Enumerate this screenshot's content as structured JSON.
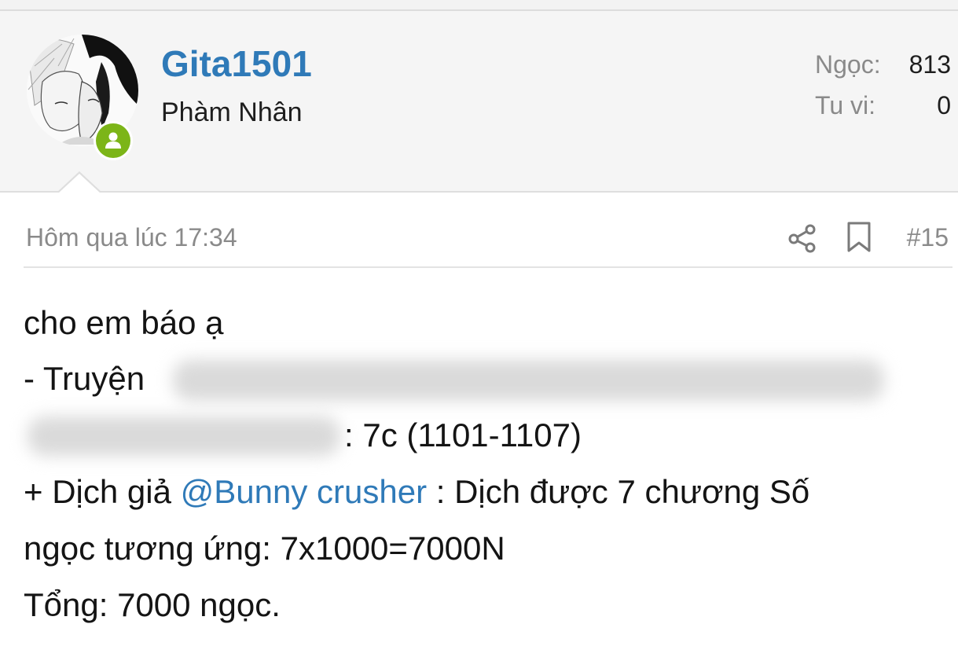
{
  "user": {
    "name": "Gita1501",
    "rank": "Phàm Nhân",
    "stats": [
      {
        "label": "Ngọc:",
        "value": "813"
      },
      {
        "label": "Tu vi:",
        "value": "0"
      }
    ]
  },
  "post": {
    "date": "Hôm qua lúc 17:34",
    "number": "#15",
    "lines": {
      "l1": "cho em báo ạ",
      "l2": "- Truyện",
      "l3": ": 7c (1101-1107)",
      "l4_pre": "+ Dịch giả ",
      "l4_mention": "@Bunny crusher",
      "l4_post": " : Dịch được 7 chương Số",
      "l5": "ngọc tương ứng: 7x1000=7000N",
      "l6": "Tổng: 7000 ngọc."
    }
  },
  "colors": {
    "accent": "#2f7ab8",
    "online": "#7cb518",
    "muted": "#8a8a8a"
  },
  "icons": {
    "share": "share-icon",
    "bookmark": "bookmark-icon",
    "online": "user-online-icon"
  }
}
